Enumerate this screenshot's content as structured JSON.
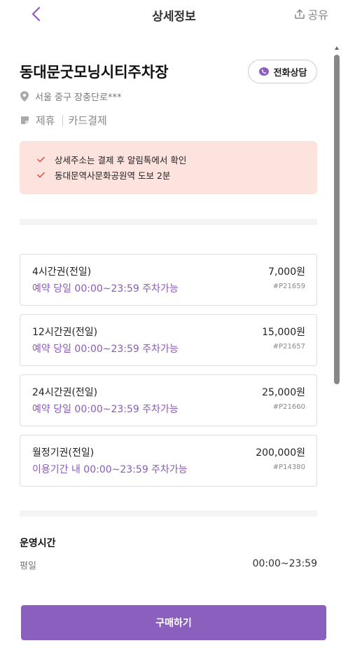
{
  "header": {
    "title": "상세정보",
    "share_label": "공유"
  },
  "place": {
    "name": "동대문굿모닝시티주차장",
    "call_label": "전화상담",
    "address": "서울 중구 장충단로***",
    "tags": [
      "제휴",
      "카드결제"
    ]
  },
  "notice": {
    "items": [
      "상세주소는 결제 후 알림톡에서 확인",
      "동대문역사문화공원역 도보 2분"
    ]
  },
  "tickets": [
    {
      "name": "4시간권(전일)",
      "desc": "예약 당일 00:00~23:59 주차가능",
      "price": "7,000원",
      "code": "#P21659"
    },
    {
      "name": "12시간권(전일)",
      "desc": "예약 당일 00:00~23:59 주차가능",
      "price": "15,000원",
      "code": "#P21657"
    },
    {
      "name": "24시간권(전일)",
      "desc": "예약 당일 00:00~23:59 주차가능",
      "price": "25,000원",
      "code": "#P21660"
    },
    {
      "name": "월정기권(전일)",
      "desc": "이용기간 내 00:00~23:59 주차가능",
      "price": "200,000원",
      "code": "#P14380"
    }
  ],
  "hours": {
    "title": "운영시간",
    "label": "평일",
    "value": "00:00~23:59"
  },
  "footer": {
    "buy_label": "구매하기"
  },
  "colors": {
    "accent": "#8a5fbd",
    "notice_bg": "#fde3de",
    "check": "#e05a4e"
  },
  "icons": [
    "back-arrow-icon",
    "share-icon",
    "phone-chat-icon",
    "location-pin-icon",
    "card-tag-icon",
    "check-icon"
  ]
}
